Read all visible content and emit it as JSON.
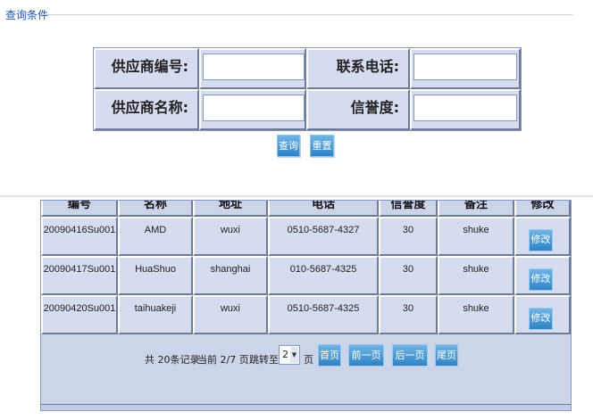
{
  "legend": {
    "title": "查询条件"
  },
  "query": {
    "supplier_no_label": "供应商编号:",
    "supplier_no_value": "",
    "phone_label": "联系电话:",
    "phone_value": "",
    "supplier_name_label": "供应商名称:",
    "supplier_name_value": "",
    "credit_label": "信誉度:",
    "credit_value": "",
    "search_button": "查询",
    "reset_button": "重置"
  },
  "table": {
    "headers": [
      "编号",
      "名称",
      "地址",
      "电话",
      "信誉度",
      "备注",
      "修改"
    ],
    "rows": [
      {
        "id": "20090416Su001",
        "name": "AMD",
        "address": "wuxi",
        "phone": "0510-5687-4327",
        "credit": "30",
        "remark": "shuke",
        "edit": "修改"
      },
      {
        "id": "20090417Su001",
        "name": "HuaShuo",
        "address": "shanghai",
        "phone": "010-5687-4325",
        "credit": "30",
        "remark": "shuke",
        "edit": "修改"
      },
      {
        "id": "20090420Su001",
        "name": "taihuakeji",
        "address": "wuxi",
        "phone": "0510-5687-4325",
        "credit": "30",
        "remark": "shuke",
        "edit": "修改"
      }
    ]
  },
  "pager": {
    "total_text": "共 20条记录",
    "current_text": "当前 2/7 页",
    "jump_label": "跳转至",
    "jump_value": "2",
    "page_unit": "页",
    "first": "首页",
    "prev": "前一页",
    "next": "后一页",
    "last": "尾页"
  }
}
